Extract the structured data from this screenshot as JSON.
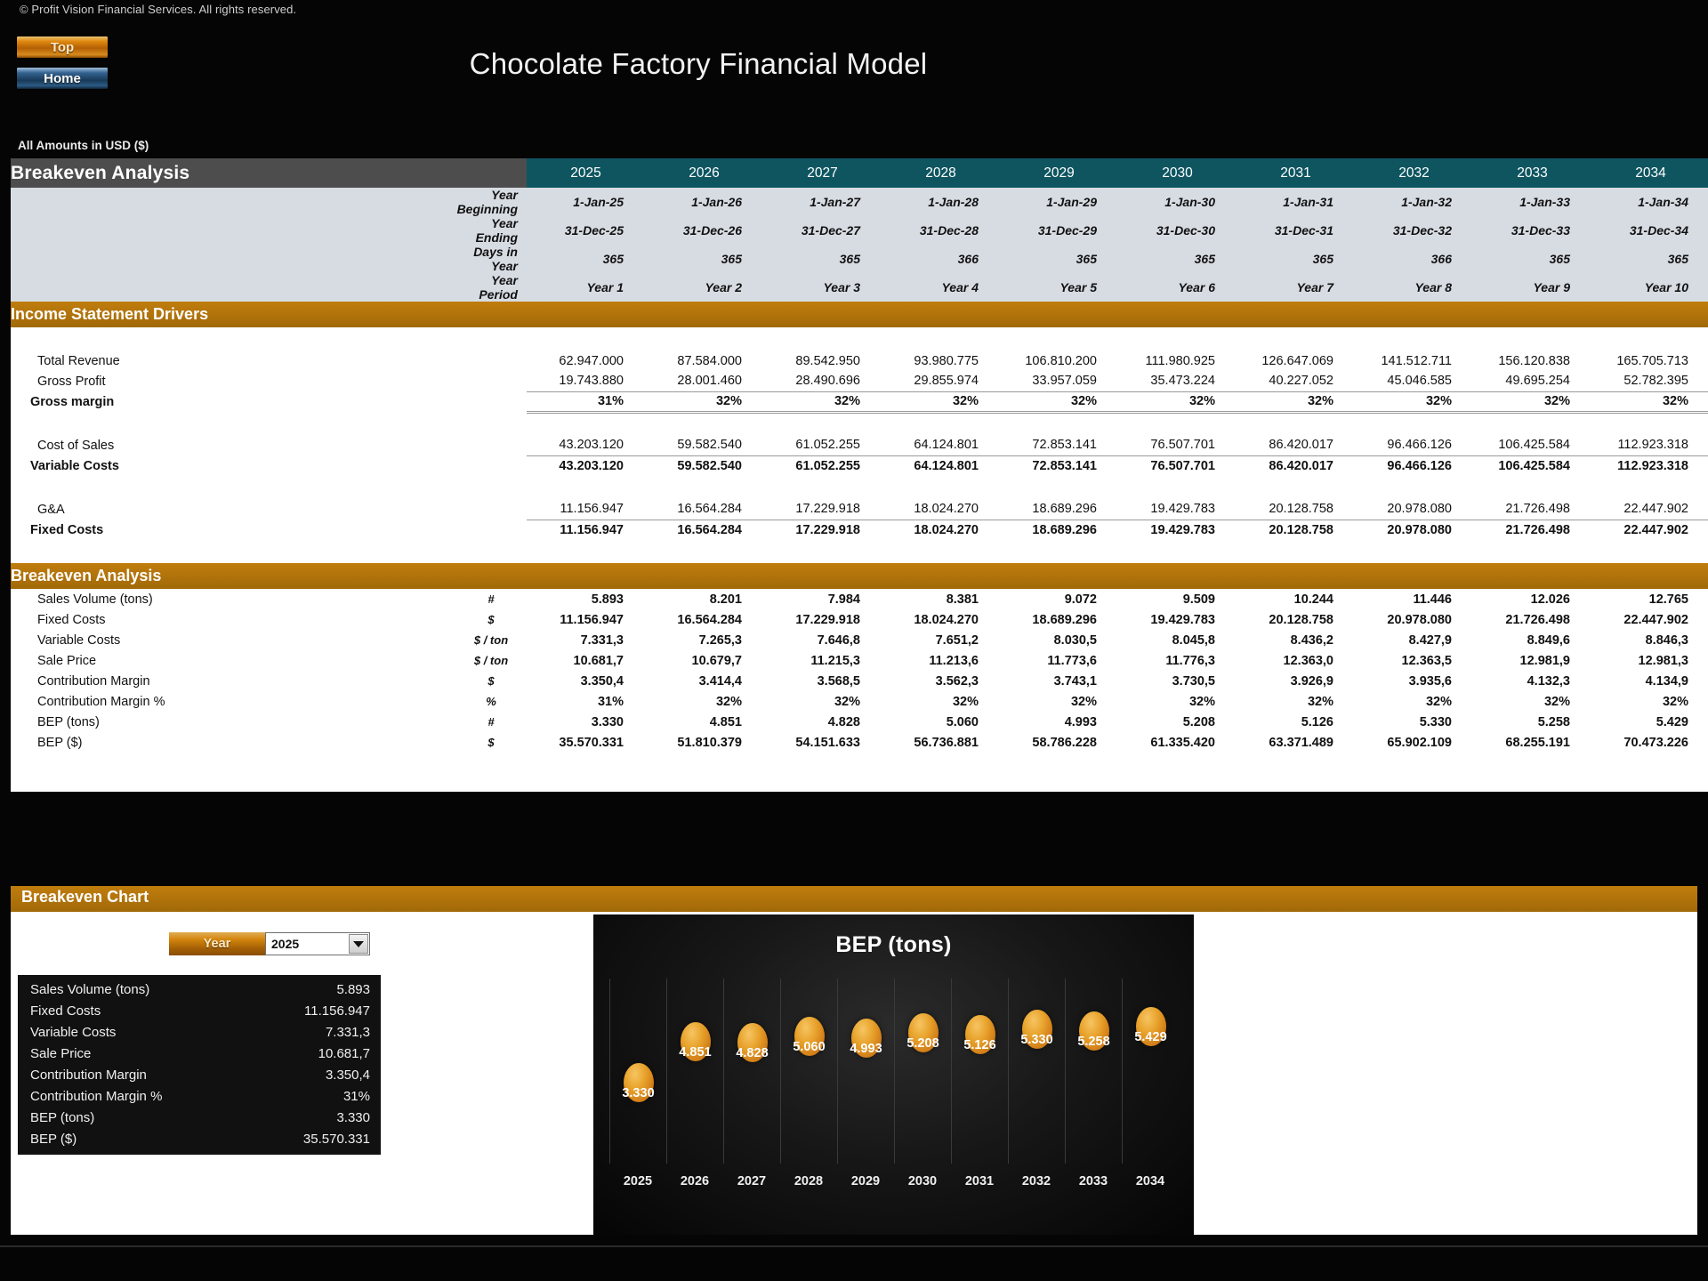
{
  "header": {
    "copyright": "© Profit Vision Financial Services. All rights reserved.",
    "top_button": "Top",
    "home_button": "Home",
    "model_title": "Chocolate Factory Financial Model",
    "amounts_note": "All Amounts in  USD ($)"
  },
  "sheet": {
    "title": "Breakeven Analysis",
    "years": [
      "2025",
      "2026",
      "2027",
      "2028",
      "2029",
      "2030",
      "2031",
      "2032",
      "2033",
      "2034"
    ],
    "period_rows": [
      {
        "label": "Year Beginning",
        "values": [
          "1-Jan-25",
          "1-Jan-26",
          "1-Jan-27",
          "1-Jan-28",
          "1-Jan-29",
          "1-Jan-30",
          "1-Jan-31",
          "1-Jan-32",
          "1-Jan-33",
          "1-Jan-34"
        ]
      },
      {
        "label": "Year Ending",
        "values": [
          "31-Dec-25",
          "31-Dec-26",
          "31-Dec-27",
          "31-Dec-28",
          "31-Dec-29",
          "31-Dec-30",
          "31-Dec-31",
          "31-Dec-32",
          "31-Dec-33",
          "31-Dec-34"
        ]
      },
      {
        "label": "Days in Year",
        "values": [
          "365",
          "365",
          "365",
          "366",
          "365",
          "365",
          "365",
          "366",
          "365",
          "365"
        ]
      },
      {
        "label": "Year Period",
        "values": [
          "Year 1",
          "Year 2",
          "Year 3",
          "Year 4",
          "Year 5",
          "Year 6",
          "Year 7",
          "Year 8",
          "Year 9",
          "Year 10"
        ]
      }
    ]
  },
  "income_drivers": {
    "section_title": "Income Statement Drivers",
    "rows": [
      {
        "label": "Total Revenue",
        "values": [
          "62.947.000",
          "87.584.000",
          "89.542.950",
          "93.980.775",
          "106.810.200",
          "111.980.925",
          "126.647.069",
          "141.512.711",
          "156.120.838",
          "165.705.713"
        ]
      },
      {
        "label": "Gross Profit",
        "values": [
          "19.743.880",
          "28.001.460",
          "28.490.696",
          "29.855.974",
          "33.957.059",
          "35.473.224",
          "40.227.052",
          "45.046.585",
          "49.695.254",
          "52.782.395"
        ]
      },
      {
        "label": "Gross margin",
        "values": [
          "31%",
          "32%",
          "32%",
          "32%",
          "32%",
          "32%",
          "32%",
          "32%",
          "32%",
          "32%"
        ]
      },
      {
        "label": "Cost of Sales",
        "values": [
          "43.203.120",
          "59.582.540",
          "61.052.255",
          "64.124.801",
          "72.853.141",
          "76.507.701",
          "86.420.017",
          "96.466.126",
          "106.425.584",
          "112.923.318"
        ]
      },
      {
        "label": "Variable Costs",
        "values": [
          "43.203.120",
          "59.582.540",
          "61.052.255",
          "64.124.801",
          "72.853.141",
          "76.507.701",
          "86.420.017",
          "96.466.126",
          "106.425.584",
          "112.923.318"
        ]
      },
      {
        "label": "G&A",
        "values": [
          "11.156.947",
          "16.564.284",
          "17.229.918",
          "18.024.270",
          "18.689.296",
          "19.429.783",
          "20.128.758",
          "20.978.080",
          "21.726.498",
          "22.447.902"
        ]
      },
      {
        "label": "Fixed Costs",
        "values": [
          "11.156.947",
          "16.564.284",
          "17.229.918",
          "18.024.270",
          "18.689.296",
          "19.429.783",
          "20.128.758",
          "20.978.080",
          "21.726.498",
          "22.447.902"
        ]
      }
    ]
  },
  "breakeven": {
    "section_title": "Breakeven Analysis",
    "rows": [
      {
        "label": "Sales Volume (tons)",
        "unit": "#",
        "values": [
          "5.893",
          "8.201",
          "7.984",
          "8.381",
          "9.072",
          "9.509",
          "10.244",
          "11.446",
          "12.026",
          "12.765"
        ]
      },
      {
        "label": "Fixed Costs",
        "unit": "$",
        "values": [
          "11.156.947",
          "16.564.284",
          "17.229.918",
          "18.024.270",
          "18.689.296",
          "19.429.783",
          "20.128.758",
          "20.978.080",
          "21.726.498",
          "22.447.902"
        ]
      },
      {
        "label": "Variable Costs",
        "unit": "$ / ton",
        "values": [
          "7.331,3",
          "7.265,3",
          "7.646,8",
          "7.651,2",
          "8.030,5",
          "8.045,8",
          "8.436,2",
          "8.427,9",
          "8.849,6",
          "8.846,3"
        ]
      },
      {
        "label": "Sale Price",
        "unit": "$ / ton",
        "values": [
          "10.681,7",
          "10.679,7",
          "11.215,3",
          "11.213,6",
          "11.773,6",
          "11.776,3",
          "12.363,0",
          "12.363,5",
          "12.981,9",
          "12.981,3"
        ]
      },
      {
        "label": "Contribution Margin",
        "unit": "$",
        "values": [
          "3.350,4",
          "3.414,4",
          "3.568,5",
          "3.562,3",
          "3.743,1",
          "3.730,5",
          "3.926,9",
          "3.935,6",
          "4.132,3",
          "4.134,9"
        ]
      },
      {
        "label": "Contribution Margin %",
        "unit": "%",
        "values": [
          "31%",
          "32%",
          "32%",
          "32%",
          "32%",
          "32%",
          "32%",
          "32%",
          "32%",
          "32%"
        ]
      },
      {
        "label": "BEP (tons)",
        "unit": "#",
        "values": [
          "3.330",
          "4.851",
          "4.828",
          "5.060",
          "4.993",
          "5.208",
          "5.126",
          "5.330",
          "5.258",
          "5.429"
        ]
      },
      {
        "label": "BEP ($)",
        "unit": "$",
        "values": [
          "35.570.331",
          "51.810.379",
          "54.151.633",
          "56.736.881",
          "58.786.228",
          "61.335.420",
          "63.371.489",
          "65.902.109",
          "68.255.191",
          "70.473.226"
        ]
      }
    ]
  },
  "chart_section": {
    "section_title": "Breakeven Chart",
    "year_label": "Year",
    "selected_year": "2025",
    "summary": [
      {
        "key": "Sales Volume (tons)",
        "value": "5.893"
      },
      {
        "key": "Fixed Costs",
        "value": "11.156.947"
      },
      {
        "key": "Variable Costs",
        "value": "7.331,3"
      },
      {
        "key": "Sale Price",
        "value": "10.681,7"
      },
      {
        "key": "Contribution Margin",
        "value": "3.350,4"
      },
      {
        "key": "Contribution Margin %",
        "value": "31%"
      },
      {
        "key": "BEP (tons)",
        "value": "3.330"
      },
      {
        "key": "BEP ($)",
        "value": "35.570.331"
      }
    ]
  },
  "chart_data": {
    "type": "scatter",
    "title": "BEP (tons)",
    "xlabel": "",
    "ylabel": "",
    "categories": [
      "2025",
      "2026",
      "2027",
      "2028",
      "2029",
      "2030",
      "2031",
      "2032",
      "2033",
      "2034"
    ],
    "values": [
      3330,
      4851,
      4828,
      5060,
      4993,
      5208,
      5126,
      5330,
      5258,
      5429
    ],
    "data_labels": [
      "3.330",
      "4.851",
      "4.828",
      "5.060",
      "4.993",
      "5.208",
      "5.126",
      "5.330",
      "5.258",
      "5.429"
    ],
    "ylim": [
      0,
      6000
    ],
    "grid": false,
    "legend": "none",
    "marker": "bubble",
    "marker_color": "#e8a32c",
    "background": "#121212"
  },
  "colors": {
    "accent_orange": "#b3740b",
    "header_teal": "#0e5560",
    "title_gray": "#4d4d4d",
    "header_band": "#d7dce3",
    "panel_black": "#111111"
  }
}
